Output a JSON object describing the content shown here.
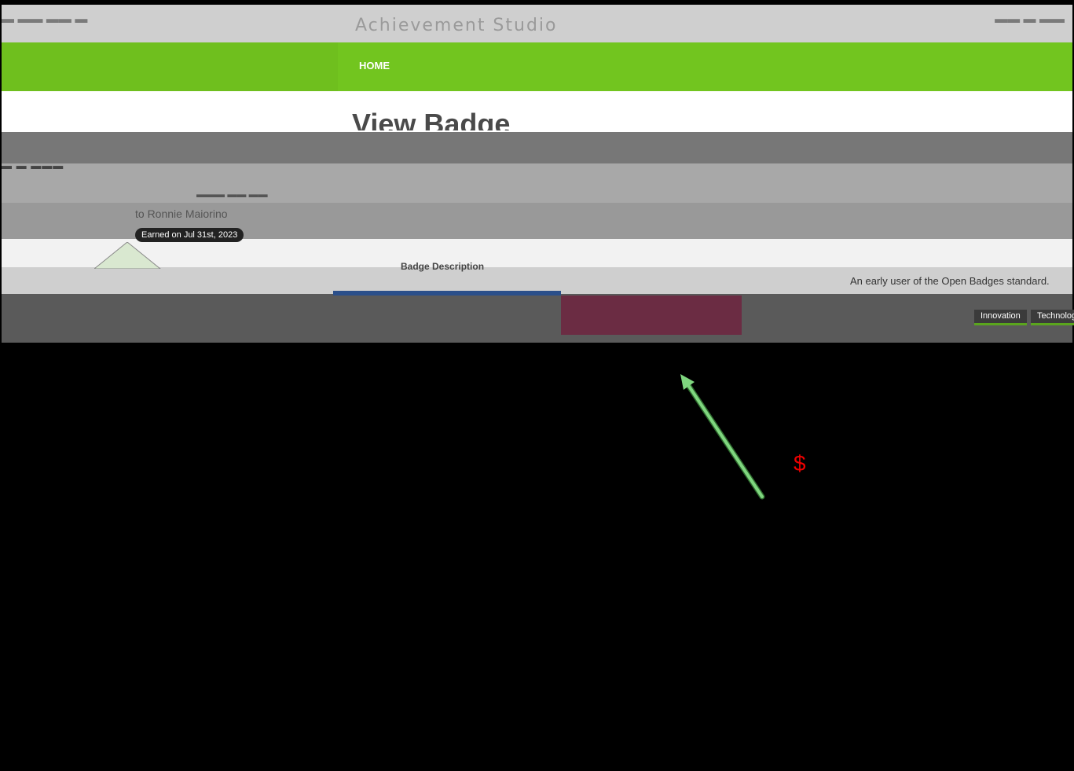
{
  "header": {
    "site_title": "Achievement Studio",
    "nav_home": "HOME"
  },
  "page": {
    "title": "View Badge"
  },
  "badge": {
    "recipient_line": "to Ronnie Maiorino",
    "earned_on": "Earned on Jul 31st, 2023",
    "description_label": "Badge Description",
    "tagline": "An early user of the Open Badges standard.",
    "tags": [
      "Innovation",
      "Technology"
    ]
  },
  "annotation": {
    "symbol": "$",
    "arrow_color": "#7fd67f",
    "symbol_color": "#e00000"
  }
}
